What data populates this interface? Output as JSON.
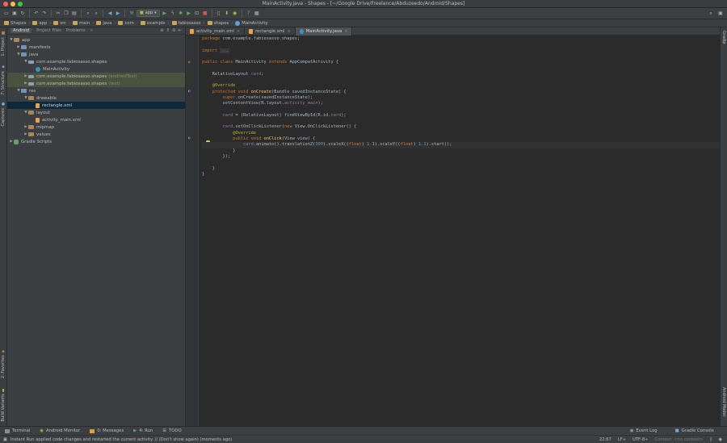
{
  "window": {
    "title": "MainActivity.java - Shapes - [~/Google Drive/Freelance/Abduzeedo/Android/Shapes]"
  },
  "toolbar": {
    "run_config": "app"
  },
  "breadcrumbs": [
    "Shapes",
    "app",
    "src",
    "main",
    "java",
    "com",
    "example",
    "fabiosasso",
    "shapes",
    "MainActivity"
  ],
  "project_panel": {
    "view_tabs": [
      "Android",
      "Project Files",
      "Problems"
    ],
    "active_view": "Android",
    "tree": [
      {
        "label": "app",
        "suffix": "",
        "depth": 0,
        "arrow": "open",
        "icon": "folder"
      },
      {
        "label": "manifests",
        "suffix": "",
        "depth": 1,
        "arrow": "closed",
        "icon": "blue"
      },
      {
        "label": "java",
        "suffix": "",
        "depth": 1,
        "arrow": "open",
        "icon": "blue"
      },
      {
        "label": "com.example.fabiosasso.shapes",
        "suffix": "",
        "depth": 2,
        "arrow": "open",
        "icon": "pkg"
      },
      {
        "label": "MainActivity",
        "suffix": "",
        "depth": 3,
        "arrow": "",
        "icon": "cls"
      },
      {
        "label": "com.example.fabiosasso.shapes",
        "suffix": "(androidTest)",
        "depth": 2,
        "arrow": "closed",
        "icon": "pkg",
        "hl": true
      },
      {
        "label": "com.example.fabiosasso.shapes",
        "suffix": "(test)",
        "depth": 2,
        "arrow": "closed",
        "icon": "pkg",
        "hl": true
      },
      {
        "label": "res",
        "suffix": "",
        "depth": 1,
        "arrow": "open",
        "icon": "blue"
      },
      {
        "label": "drawable",
        "suffix": "",
        "depth": 2,
        "arrow": "open",
        "icon": "folder"
      },
      {
        "label": "rectangle.xml",
        "suffix": "",
        "depth": 3,
        "arrow": "",
        "icon": "xml",
        "sel": true
      },
      {
        "label": "layout",
        "suffix": "",
        "depth": 2,
        "arrow": "open",
        "icon": "folder"
      },
      {
        "label": "activity_main.xml",
        "suffix": "",
        "depth": 3,
        "arrow": "",
        "icon": "xml"
      },
      {
        "label": "mipmap",
        "suffix": "",
        "depth": 2,
        "arrow": "closed",
        "icon": "folder"
      },
      {
        "label": "values",
        "suffix": "",
        "depth": 2,
        "arrow": "closed",
        "icon": "folder"
      },
      {
        "label": "Gradle Scripts",
        "suffix": "",
        "depth": 0,
        "arrow": "closed",
        "icon": "gradle"
      }
    ]
  },
  "left_tool_tabs": [
    "1: Project",
    "7: Structure",
    "Captures",
    "2: Favorites",
    "Build Variants"
  ],
  "right_tool_tabs": [
    "Gradle",
    "Android Model"
  ],
  "editor_tabs": [
    {
      "label": "activity_main.xml",
      "icon": "xml",
      "active": false
    },
    {
      "label": "rectangle.xml",
      "icon": "xml",
      "active": false
    },
    {
      "label": "MainActivity.java",
      "icon": "cls",
      "active": true
    }
  ],
  "code_lines": [
    [
      [
        "kw",
        "package "
      ],
      [
        "",
        "com.example.fabiosasso.shapes;"
      ]
    ],
    [],
    [
      [
        "kw",
        "import "
      ],
      [
        "fold",
        "..."
      ]
    ],
    [],
    [
      [
        "kw",
        "public class "
      ],
      [
        "",
        "MainActivity "
      ],
      [
        "kw",
        "extends "
      ],
      [
        "",
        "AppCompatActivity {"
      ]
    ],
    [],
    [
      [
        "",
        "    RelativeLayout "
      ],
      [
        "fld",
        "card"
      ],
      [
        "",
        ";"
      ]
    ],
    [],
    [
      [
        "ann",
        "    @Override"
      ]
    ],
    [
      [
        "kw",
        "    protected void "
      ],
      [
        "fn",
        "onCreate"
      ],
      [
        "",
        "(Bundle savedInstanceState) {"
      ]
    ],
    [
      [
        "kw",
        "        super"
      ],
      [
        "",
        ".onCreate(savedInstanceState);"
      ]
    ],
    [
      [
        "",
        "        setContentView(R.layout."
      ],
      [
        "it",
        "activity_main"
      ],
      [
        "",
        ");"
      ]
    ],
    [],
    [
      [
        "fld",
        "        card "
      ],
      [
        "",
        "= (RelativeLayout) findViewById(R.id."
      ],
      [
        "fld",
        "card"
      ],
      [
        "",
        ");"
      ]
    ],
    [],
    [
      [
        "fld",
        "        card"
      ],
      [
        "",
        ".setOnClickListener("
      ],
      [
        "kw",
        "new "
      ],
      [
        "",
        "View.OnClickListener() {"
      ]
    ],
    [
      [
        "ann",
        "            @Override"
      ]
    ],
    [
      [
        "kw",
        "            public void "
      ],
      [
        "fn",
        "onClick"
      ],
      [
        "",
        "(View view) {"
      ]
    ],
    [
      [
        "fld",
        "                card"
      ],
      [
        "",
        ".animate().translationZ("
      ],
      [
        "num",
        "300"
      ],
      [
        "",
        ").scaleX(("
      ],
      [
        "kw",
        "float"
      ],
      [
        "",
        ") "
      ],
      [
        "num",
        "1."
      ],
      [
        "",
        "1).scaleY(("
      ],
      [
        "kw",
        "float"
      ],
      [
        "",
        ") "
      ],
      [
        "num",
        "1.1"
      ],
      [
        "",
        ").start();"
      ]
    ],
    [
      [
        "",
        "            }"
      ]
    ],
    [
      [
        "",
        "        });"
      ]
    ],
    [],
    [
      [
        "",
        "    }"
      ]
    ],
    [
      [
        "",
        "}"
      ]
    ]
  ],
  "bottom_tools": [
    "Terminal",
    "Android Monitor",
    "0: Messages",
    "4: Run",
    "TODO"
  ],
  "bottom_tools_right": [
    "Event Log",
    "Gradle Console"
  ],
  "status": {
    "message": "Instant Run applied code changes and restarted the current activity. // (Don't show again) (moments ago)",
    "position": "22:67",
    "line_sep": "LF÷",
    "encoding": "UTF-8÷",
    "context": "Context: <no context>"
  }
}
